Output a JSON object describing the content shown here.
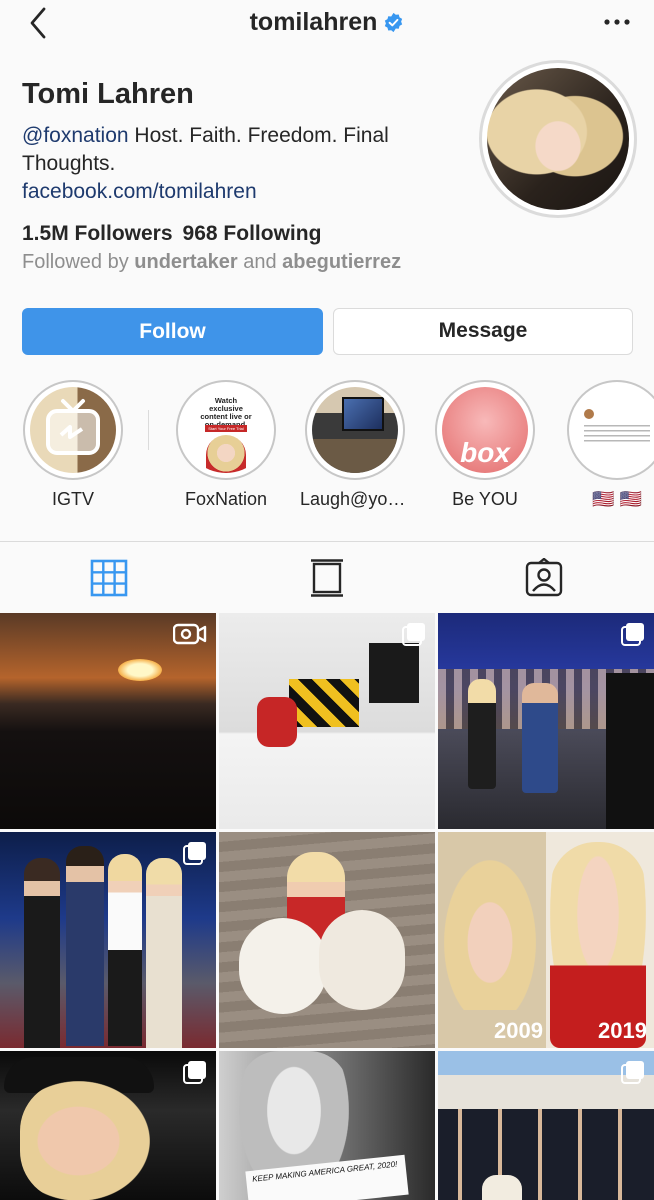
{
  "header": {
    "username": "tomilahren",
    "back_icon": "chevron-left-icon",
    "verified_icon": "verified-badge-icon",
    "more_icon": "more-horizontal-icon"
  },
  "profile": {
    "name": "Tomi Lahren",
    "bio_mention": "@foxnation",
    "bio_text": " Host. Faith. Freedom. Final Thoughts.",
    "link": "facebook.com/tomilahren",
    "followers": "1.5M Followers",
    "following": "968 Following",
    "followed_by_prefix": "Followed by ",
    "followed_by_user1": "undertaker",
    "followed_by_and": " and ",
    "followed_by_user2": "abegutierrez"
  },
  "buttons": {
    "follow": "Follow",
    "message": "Message"
  },
  "highlights": [
    {
      "label": "IGTV"
    },
    {
      "label": "FoxNation",
      "card_title": "Watch exclusive content live or on-demand.",
      "card_button": "Start Your Free Trial"
    },
    {
      "label": "Laugh@you..."
    },
    {
      "label": "Be YOU",
      "overlay_text": "box"
    },
    {
      "label": "🇺🇸 🇺🇸"
    }
  ],
  "tabs": {
    "grid": "grid-icon",
    "feed": "feed-list-icon",
    "tagged": "tagged-person-icon"
  },
  "grid_labels": {
    "year_left": "2009",
    "year_right": "2019",
    "sign_text": "KEEP MAKING AMERICA GREAT, 2020!"
  },
  "colors": {
    "follow_button": "#3f94e9",
    "link": "#1e3a6e",
    "muted": "#8e8e8e",
    "verified": "#3897f0"
  }
}
